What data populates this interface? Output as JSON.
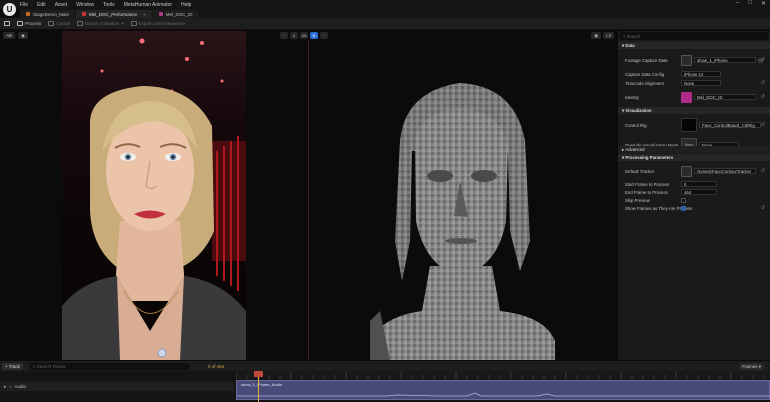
{
  "menubar": {
    "items": [
      "File",
      "Edit",
      "Asset",
      "Window",
      "Tools",
      "MetaHuman Animator",
      "Help"
    ],
    "logo": "U"
  },
  "tabs": [
    {
      "label": "StageDemo_Main",
      "active": false
    },
    {
      "label": "Mel_DOC_Performance",
      "active": true,
      "close": "×"
    },
    {
      "label": "Mel_DOC_ID",
      "active": false
    }
  ],
  "toolbar": {
    "process": "Process",
    "cancel": "Cancel",
    "export_animation": "Export Animation",
    "export_level_sequence": "Export Level Sequence"
  },
  "viewport": {
    "left_pill": "AB",
    "mode_a": "A",
    "mode_ab": "AB",
    "mode_b": "B",
    "right_pill": "Lit"
  },
  "details": {
    "search_placeholder": "Search",
    "sections": {
      "data": "Data",
      "visualization": "Visualization",
      "advanced": "Advanced",
      "processing": "Processing Parameters"
    },
    "rows": {
      "footage_label": "Footage Capture Data",
      "footage_value": "show_1_iPhone",
      "capture_config_label": "Capture Data Config",
      "capture_config_value": "iPhone 12",
      "timecode_label": "Timecode Alignment",
      "timecode_value": "None",
      "identity_label": "Identity",
      "identity_value": "Mel_DOC_ID",
      "control_rig_label": "Control Rig",
      "control_rig_value": "Face_ControlBoard_CtrlRig",
      "override_mesh_label": "Override Visualization Mesh",
      "override_mesh_value": "None",
      "default_tracker_label": "Default Tracker",
      "default_tracker_value": "GenericFaceContourTracker",
      "start_frame_label": "Start Frame to Process",
      "start_frame_value": "0",
      "end_frame_label": "End Frame to Process",
      "end_frame_value": "464",
      "skip_preview_label": "Skip Preview",
      "show_frames_label": "Show Frames as They Are Process"
    }
  },
  "sequencer": {
    "track_button": "+ Track",
    "search_placeholder": "Search Tracks",
    "frame_counter": "0 of 464",
    "frames_combo": "Frames",
    "audio_track": "Audio",
    "clip_label": "show_1_iPhone_Audio"
  }
}
